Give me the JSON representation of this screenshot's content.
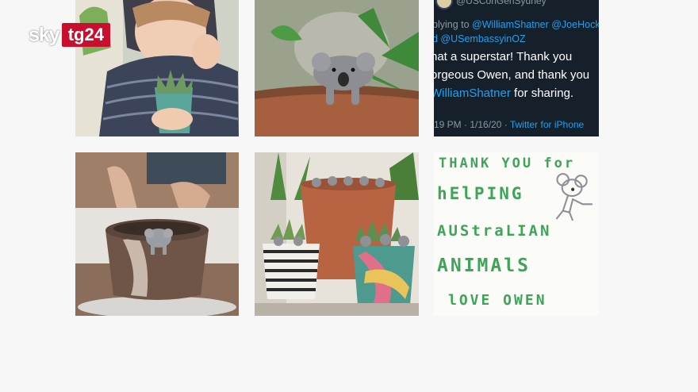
{
  "logo": {
    "sky": "sky",
    "tg": "tg24"
  },
  "tweet": {
    "handle": "@USConGenSydney",
    "reply_prefix": "plying to ",
    "reply_mentions_1": "@WilliamShatner @JoeHock",
    "reply_mentions_2": "d @USembassyinOZ",
    "body_line1": "hat a superstar! Thank you",
    "body_line2": "orgeous Owen, and thank you",
    "body_mention": "WilliamShatner",
    "body_line3_suffix": " for sharing.",
    "timestamp": "19 PM · 1/16/20 · ",
    "source": "Twitter for iPhone"
  },
  "drawing": {
    "line1": "THANK YOU for",
    "line2": "hElPING",
    "line3": "AUStraLIAN",
    "line4": "ANIMAlS",
    "line5": "lOVE OWEN"
  },
  "colors": {
    "background": "#f7f7f7",
    "brand_red": "#c8102e",
    "twitter_blue": "#1da1f2",
    "twitter_bg": "#15202b",
    "crayon_green": "#3fa45a"
  }
}
